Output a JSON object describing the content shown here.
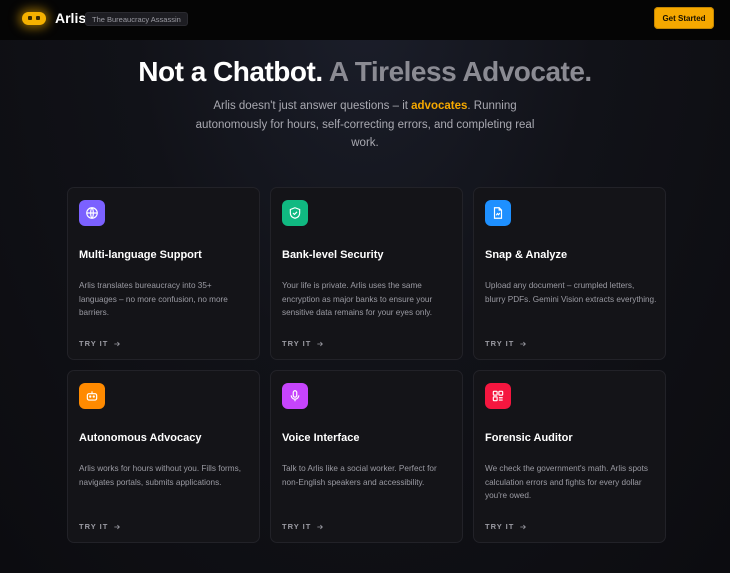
{
  "header": {
    "brand": "Arlis",
    "tagline": "The Bureaucracy Assassin",
    "cta_label": "Get Started"
  },
  "hero": {
    "title_part1": "Not a Chatbot.",
    "title_part2": "A Tireless Advocate.",
    "subtitle_before": "Arlis doesn't just answer questions – it ",
    "subtitle_highlight": "advocates",
    "subtitle_after": ". Running autonomously for hours, self-correcting errors, and completing real work."
  },
  "colors": {
    "accent": "#f5a800",
    "background": "#0c0c10"
  },
  "features": [
    {
      "icon": "globe-icon",
      "color": "#7b61ff",
      "title": "Multi-language Support",
      "description": "Arlis translates bureaucracy into 35+ languages – no more confusion, no more barriers.",
      "action": "TRY IT"
    },
    {
      "icon": "shield-check-icon",
      "color": "#10b981",
      "title": "Bank-level Security",
      "description": "Your life is private. Arlis uses the same encryption as major banks to ensure your sensitive data remains for your eyes only.",
      "action": "TRY IT"
    },
    {
      "icon": "document-scan-icon",
      "color": "#1e90ff",
      "title": "Snap & Analyze",
      "description": "Upload any document – crumpled letters, blurry PDFs. Gemini Vision extracts everything.",
      "action": "TRY IT"
    },
    {
      "icon": "robot-icon",
      "color": "#ff8a00",
      "title": "Autonomous Advocacy",
      "description": "Arlis works for hours without you. Fills forms, navigates portals, submits applications.",
      "action": "TRY IT"
    },
    {
      "icon": "microphone-icon",
      "color": "#c644fc",
      "title": "Voice Interface",
      "description": "Talk to Arlis like a social worker. Perfect for non-English speakers and accessibility.",
      "action": "TRY IT"
    },
    {
      "icon": "grid-audit-icon",
      "color": "#f5163f",
      "title": "Forensic Auditor",
      "description": "We check the government's math. Arlis spots calculation errors and fights for every dollar you're owed.",
      "action": "TRY IT"
    }
  ]
}
